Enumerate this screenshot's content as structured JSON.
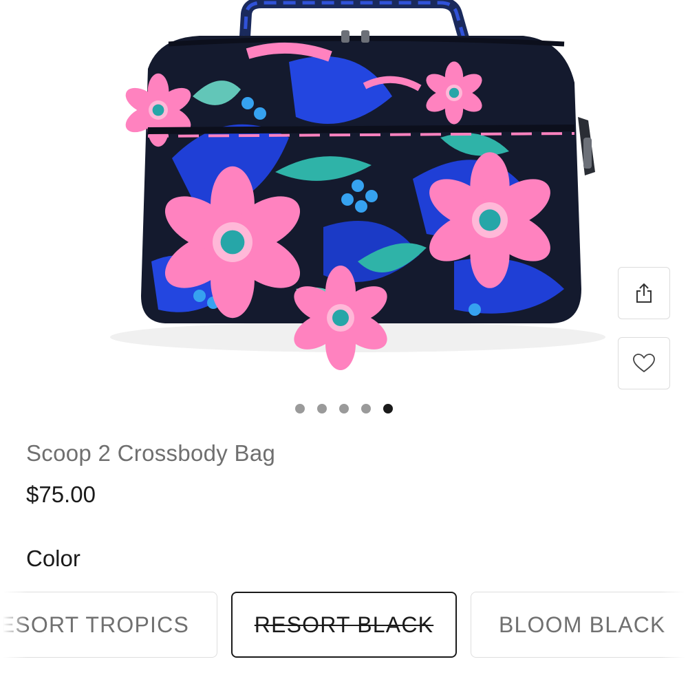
{
  "product": {
    "title": "Scoop 2 Crossbody Bag",
    "price": "$75.00",
    "image_alt": "Floral print bag"
  },
  "gallery": {
    "dot_count": 5,
    "active_dot": 5,
    "share_icon": "share-icon",
    "wishlist_icon": "heart-icon"
  },
  "color": {
    "label": "Color",
    "options": [
      {
        "label": "RESORT TROPICS",
        "visible_text": "SORT TROPICS",
        "selected": false,
        "unavailable": false
      },
      {
        "label": "RESORT BLACK",
        "selected": true,
        "unavailable": true
      },
      {
        "label": "BLOOM BLACK",
        "visible_text": "BLOOM BLACK",
        "selected": false,
        "unavailable": false
      }
    ]
  },
  "colors": {
    "bag_base": "#141a2e",
    "bag_blue": "#1f3fd6",
    "flower_pink": "#ff7ab8",
    "leaf_teal": "#2fb3a8",
    "selected_border": "#1a1a1a"
  }
}
